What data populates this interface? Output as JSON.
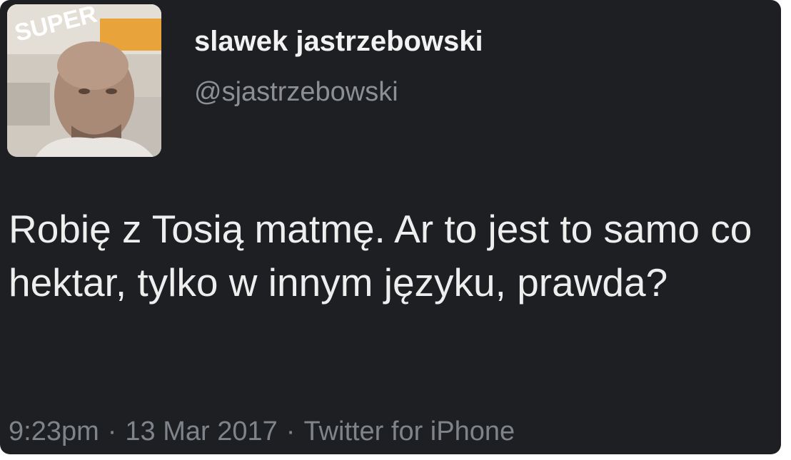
{
  "tweet": {
    "author": {
      "display_name": "slawek jastrzebowski",
      "handle": "@sjastrzebowski",
      "avatar_banner_text": "SUPER"
    },
    "text": "Robię z Tosią matmę. Ar to jest to samo co hektar, tylko w innym języku, prawda?",
    "time": "9:23pm",
    "date": "13 Mar 2017",
    "source": "Twitter for iPhone",
    "separator": "·"
  },
  "colors": {
    "card_background": "#1e1f22",
    "text_primary": "#eeeeee",
    "text_secondary": "#8b9096"
  }
}
